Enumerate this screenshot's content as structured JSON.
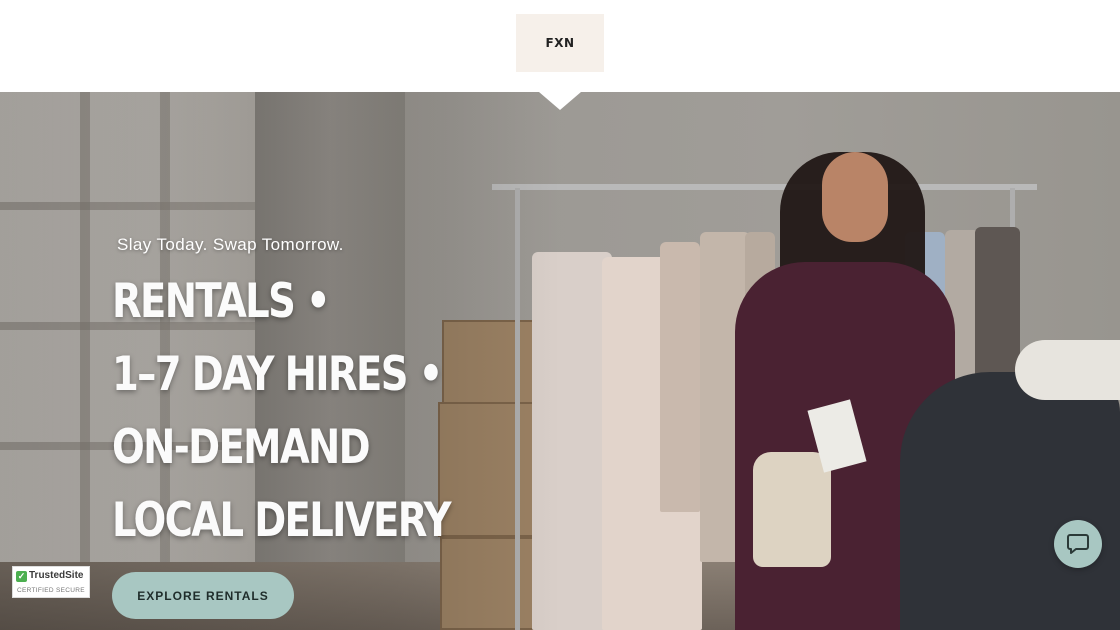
{
  "header": {
    "logo_text": "FXN"
  },
  "hero": {
    "tagline": "Slay Today. Swap Tomorrow.",
    "heading_lines": [
      "RENTALS •",
      "1–7 DAY HIRES •",
      "ON-DEMAND",
      "LOCAL DELIVERY"
    ],
    "cta_label": "EXPLORE RENTALS"
  },
  "badge": {
    "title": "TrustedSite",
    "subtitle": "CERTIFIED SECURE"
  },
  "chat_widget": {
    "icon": "chat-bubble-icon"
  },
  "colors": {
    "accent": "#a8c7c2",
    "logo_bg": "#f6f0ea",
    "heading_text": "#fbfbfb"
  }
}
